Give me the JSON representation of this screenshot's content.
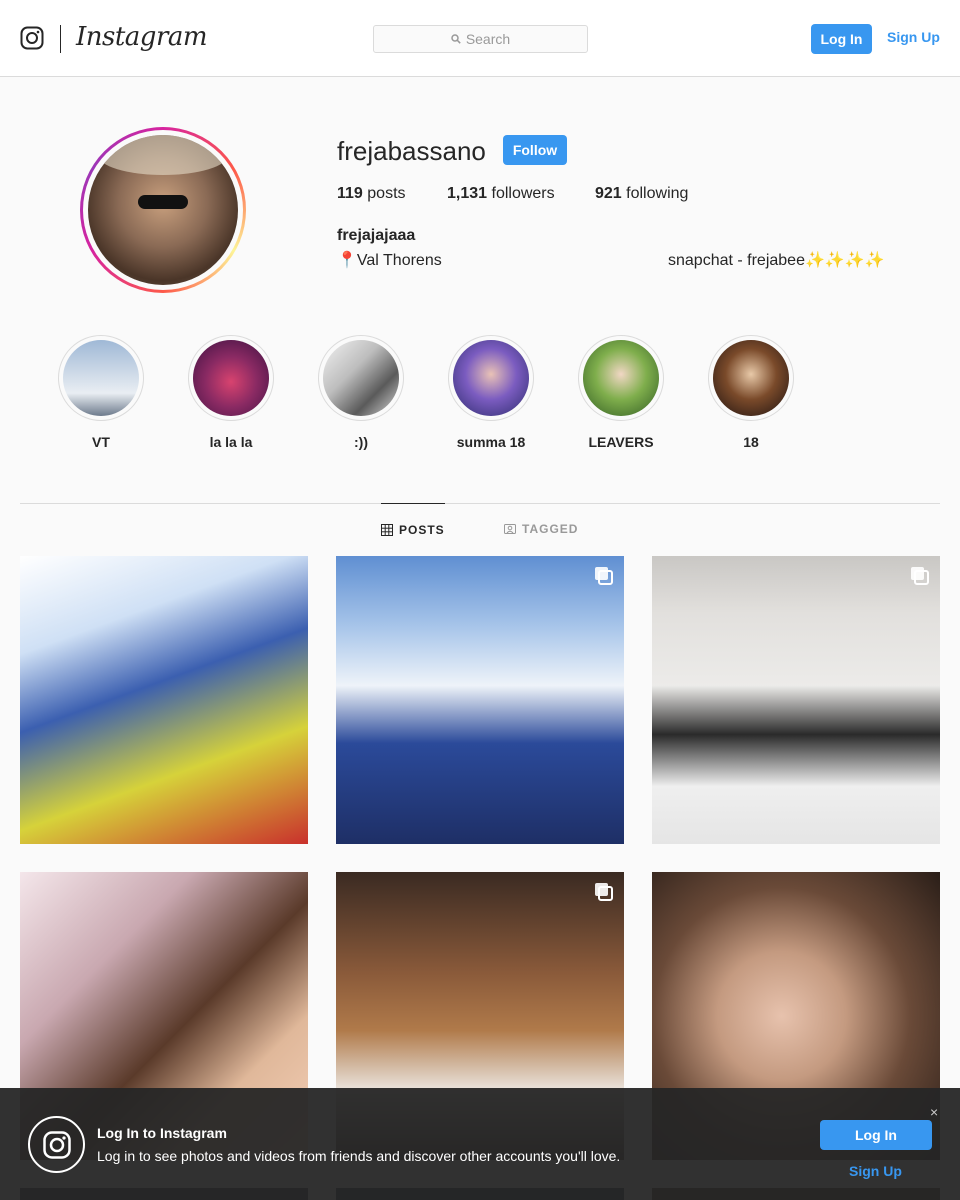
{
  "header": {
    "brand": "Instagram",
    "search_placeholder": "Search",
    "login_label": "Log In",
    "signup_label": "Sign Up"
  },
  "profile": {
    "username": "frejabassano",
    "follow_label": "Follow",
    "stats": {
      "posts_count": "119",
      "posts_label": "posts",
      "followers_count": "1,131",
      "followers_label": "followers",
      "following_count": "921",
      "following_label": "following"
    },
    "full_name": "frejajajaaa",
    "bio_location": "Val Thorens",
    "bio_snapchat": "snapchat - frejabee✨✨✨✨"
  },
  "highlights": [
    {
      "label": "VT"
    },
    {
      "label": "la la la"
    },
    {
      "label": ":))"
    },
    {
      "label": "summa 18"
    },
    {
      "label": "LEAVERS"
    },
    {
      "label": "18"
    }
  ],
  "tabs": {
    "posts": "POSTS",
    "tagged": "TAGGED"
  },
  "posts": [
    {
      "multi": false
    },
    {
      "multi": true
    },
    {
      "multi": true
    },
    {
      "multi": false
    },
    {
      "multi": true
    },
    {
      "multi": false
    }
  ],
  "banner": {
    "title": "Log In to Instagram",
    "text": "Log in to see photos and videos from friends and discover other accounts you'll love.",
    "login_label": "Log In",
    "signup_label": "Sign Up",
    "close_glyph": "×"
  },
  "colors": {
    "accent": "#3897f0",
    "text": "#262626",
    "border": "#dbdbdb",
    "banner": "#262626"
  }
}
